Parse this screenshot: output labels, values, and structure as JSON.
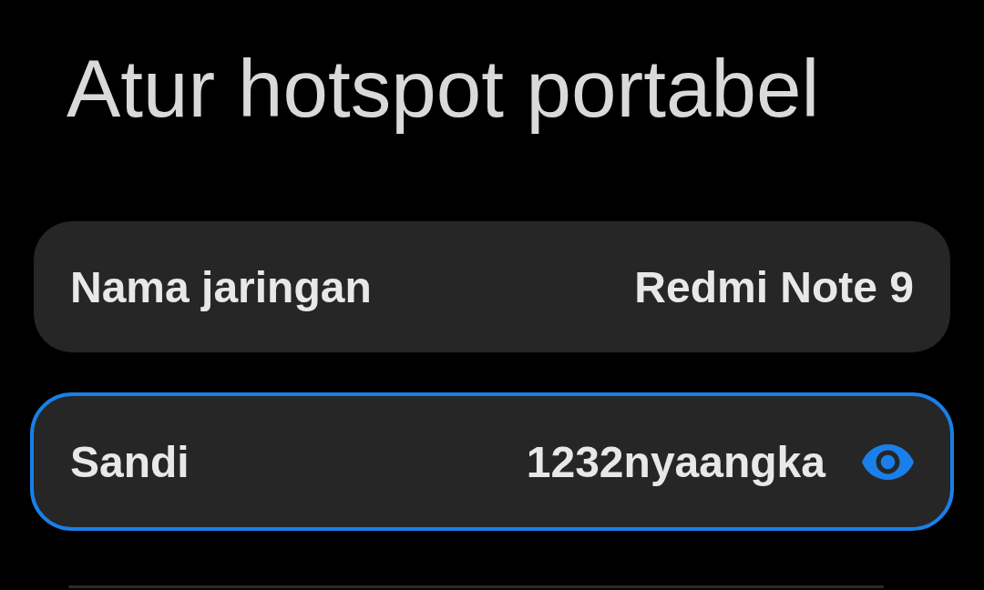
{
  "title": "Atur hotspot portabel",
  "fields": [
    {
      "kind": "text",
      "label": "Nama jaringan",
      "value": "Redmi Note 9",
      "focused": false
    },
    {
      "kind": "password",
      "label": "Sandi",
      "value": "1232nyaangka",
      "focused": true
    }
  ]
}
